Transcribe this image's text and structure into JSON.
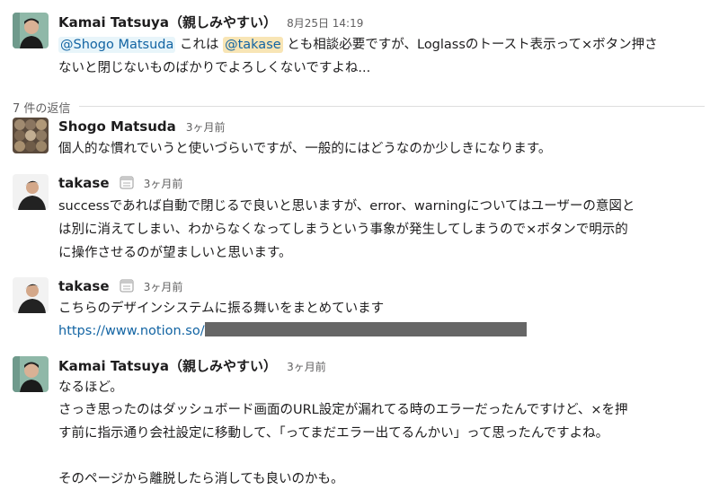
{
  "parent": {
    "author": "Kamai Tatsuya（親しみやすい）",
    "timestamp": "8月25日 14:19",
    "mention1": "@Shogo Matsuda",
    "text1": " これは ",
    "mention2": "@takase",
    "text2": " とも相談必要ですが、Loglassのトースト表示って×ボタン押さ",
    "line2": "ないと閉じないものばかりでよろしくないですよね..."
  },
  "thread": {
    "reply_count": "7 件の返信"
  },
  "replies": [
    {
      "author": "Shogo Matsuda",
      "time": "3ヶ月前",
      "lines": [
        "個人的な慣れでいうと使いづらいですが、一般的にはどうなのか少しきになります。"
      ]
    },
    {
      "author": "takase",
      "time": "3ヶ月前",
      "lines": [
        "successであれば自動で閉じるで良いと思いますが、error、warningについてはユーザーの意図と",
        "は別に消えてしまい、わからなくなってしまうという事象が発生してしまうので×ボタンで明示的",
        "に操作させるのが望ましいと思います。"
      ]
    },
    {
      "author": "takase",
      "time": "3ヶ月前",
      "lines": [
        "こちらのデザインシステムに振る舞いをまとめています"
      ],
      "link": "https://www.notion.so/"
    },
    {
      "author": "Kamai Tatsuya（親しみやすい）",
      "time": "3ヶ月前",
      "lines": [
        "なるほど。",
        "さっき思ったのはダッシュボード画面のURL設定が漏れてる時のエラーだったんですけど、×を押",
        "す前に指示通り会社設定に移動して、「ってまだエラー出てるんかい」って思ったんですよね。",
        "",
        "そのページから離脱したら消しても良いのかも。"
      ]
    }
  ],
  "icons": {
    "status_emoji": "calendar-emoji-icon"
  },
  "colors": {
    "link": "#1264a3",
    "mention_bg": "#e8f5fa",
    "mention_highlight_bg": "#f8e5b5",
    "muted": "#616061"
  }
}
